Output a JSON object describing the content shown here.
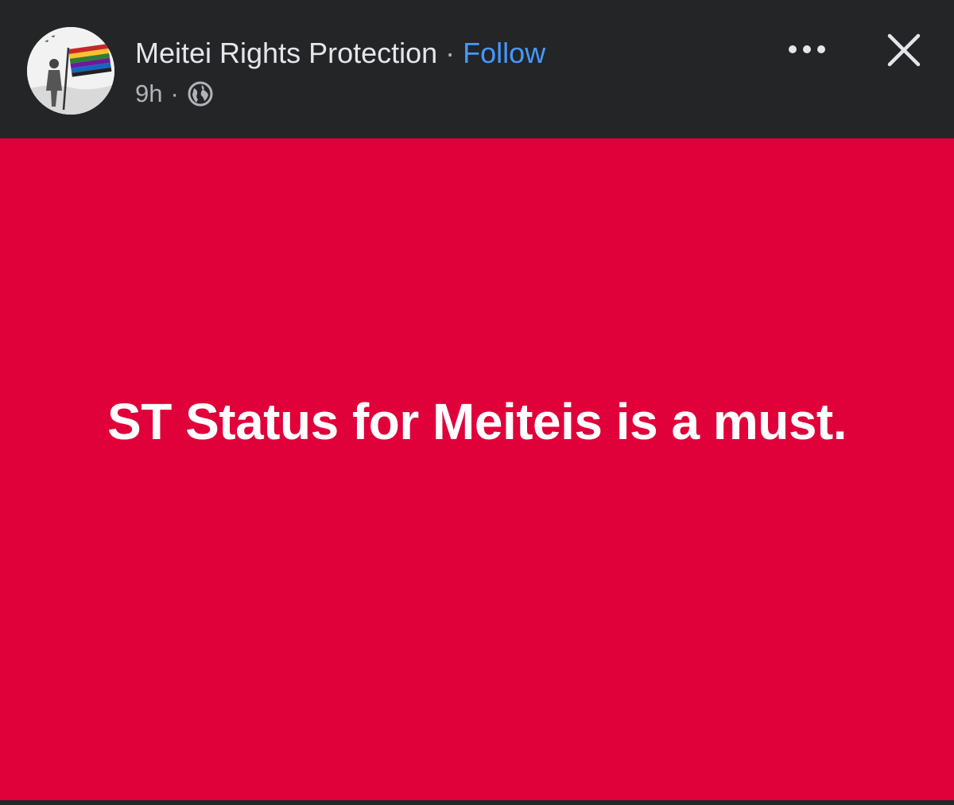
{
  "header": {
    "page_name": "Meitei Rights Protection",
    "separator": "·",
    "follow_label": "Follow",
    "timestamp": "9h",
    "meta_separator": "·",
    "audience_icon": "globe-icon",
    "more_icon": "more-horizontal-icon",
    "close_icon": "close-icon"
  },
  "post": {
    "text": "ST Status for Meiteis is a must.",
    "background_color": "#e0003a",
    "text_color": "#ffffff"
  },
  "colors": {
    "header_bg": "#242526",
    "link_blue": "#4599ff",
    "secondary_text": "#b0b3b8"
  }
}
